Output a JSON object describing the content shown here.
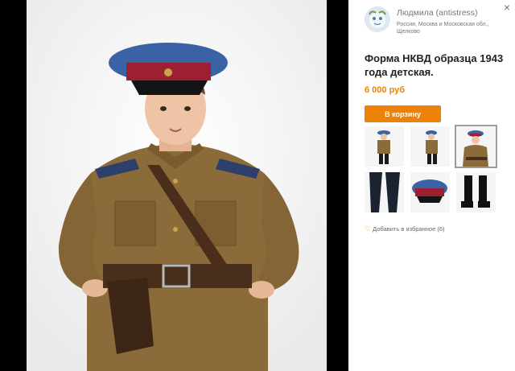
{
  "author": {
    "name": "Людмила (antistress)",
    "location": "Россия, Москва и Московская обл., Щелково"
  },
  "product": {
    "title": "Форма НКВД образца 1943 года детская.",
    "price": "6 000 руб"
  },
  "actions": {
    "cart_label": "В корзину",
    "favorites_label": "Добавить в избранное (6)",
    "close_glyph": "×"
  },
  "thumbnails": [
    {
      "icon": "thumb-full-uniform-front",
      "selected": false
    },
    {
      "icon": "thumb-full-uniform-side",
      "selected": false
    },
    {
      "icon": "thumb-boy-portrait",
      "selected": true
    },
    {
      "icon": "thumb-trousers-detail",
      "selected": false
    },
    {
      "icon": "thumb-cap-detail",
      "selected": false
    },
    {
      "icon": "thumb-boots-detail",
      "selected": false
    }
  ],
  "colors": {
    "accent": "#ee8208",
    "uniform": "#8b6b3a",
    "cap_crown": "#3a63a6",
    "cap_band": "#9c1f32"
  }
}
